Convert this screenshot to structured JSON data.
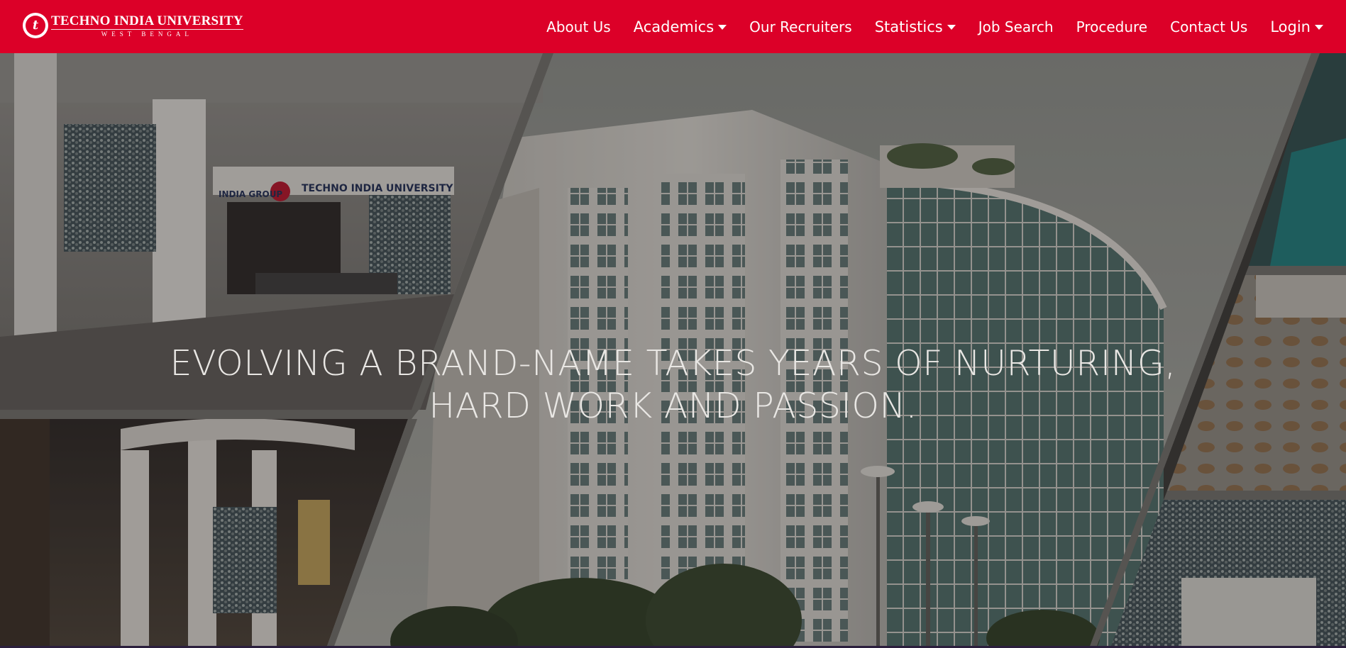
{
  "brand": {
    "logo_glyph": "t",
    "name": "TECHNO INDIA UNIVERSITY",
    "subtitle": "WEST BENGAL"
  },
  "nav": {
    "items": [
      {
        "label": "About Us",
        "has_dropdown": false
      },
      {
        "label": "Academics",
        "has_dropdown": true
      },
      {
        "label": "Our Recruiters",
        "has_dropdown": false
      },
      {
        "label": "Statistics",
        "has_dropdown": true
      },
      {
        "label": "Job Search",
        "has_dropdown": false
      },
      {
        "label": "Procedure",
        "has_dropdown": false
      },
      {
        "label": "Contact Us",
        "has_dropdown": false
      },
      {
        "label": "Login",
        "has_dropdown": true
      }
    ]
  },
  "hero": {
    "headline_line1": "EVOLVING A BRAND-NAME TAKES YEARS OF NURTURING,",
    "headline_line2": "HARD WORK AND PASSION.",
    "photo_lobby_sign_left": "INDIA GROUP",
    "photo_lobby_sign_right": "TECHNO INDIA UNIVERSITY"
  },
  "colors": {
    "brand_red": "#dc0028",
    "nav_text": "#ffffff",
    "hero_text": "#e9e7e4"
  },
  "icons": [
    "university-logo-icon",
    "caret-down-icon"
  ]
}
